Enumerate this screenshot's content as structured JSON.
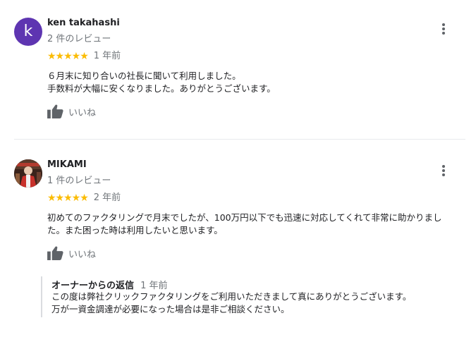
{
  "reviews": [
    {
      "avatar_letter": "k",
      "avatar_color": "#5e35b1",
      "name": "ken takahashi",
      "review_count": "2 件のレビュー",
      "stars": "★★★★★",
      "rating": 5,
      "date": "1 年前",
      "text_line1": "６月末に知り合いの社長に聞いて利用しました。",
      "text_line2": "手数料が大幅に安くなりました。ありがとうございます。",
      "like_label": "いいね"
    },
    {
      "avatar_type": "photo",
      "name": "MIKAMI",
      "review_count": "1 件のレビュー",
      "stars": "★★★★★",
      "rating": 5,
      "date": "2 年前",
      "text_line1": "初めてのファクタリングで月末でしたが、100万円以下でも迅速に対応してくれて非常に助かりまし",
      "text_line2": "た。また困った時は利用したいと思います。",
      "like_label": "いいね",
      "owner_reply": {
        "title": "オーナーからの返信",
        "date": "1 年前",
        "text_line1": "この度は弊社クリックファクタリングをご利用いただきまして真にありがとうございます。",
        "text_line2": "万が一資金調達が必要になった場合は是非ご相談ください。"
      }
    }
  ],
  "colors": {
    "star": "#fbbc04",
    "secondary_text": "#70757a",
    "icon": "#5f6368"
  },
  "icons": {
    "more": "more-vert-icon",
    "like": "thumb-up-icon"
  }
}
